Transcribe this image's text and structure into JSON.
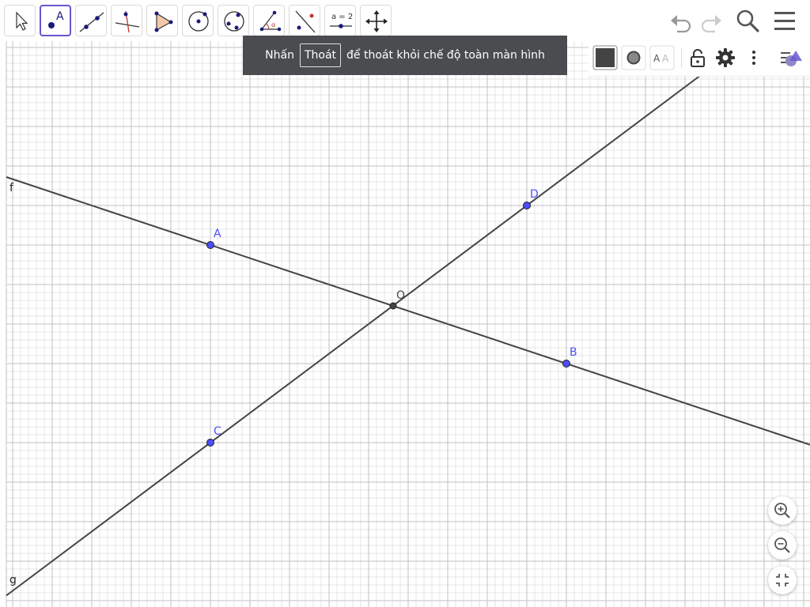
{
  "toolbar": {
    "tools": [
      {
        "name": "move-tool-icon"
      },
      {
        "name": "point-tool-icon",
        "glyph": "A"
      },
      {
        "name": "line-tool-icon"
      },
      {
        "name": "perpendicular-line-tool-icon"
      },
      {
        "name": "polygon-tool-icon"
      },
      {
        "name": "circle-center-point-tool-icon"
      },
      {
        "name": "circle-three-points-tool-icon"
      },
      {
        "name": "angle-tool-icon",
        "glyph": "α"
      },
      {
        "name": "reflect-line-tool-icon"
      },
      {
        "name": "slider-tool-icon",
        "glyph": "a = 2"
      },
      {
        "name": "move-graphics-view-tool-icon"
      }
    ],
    "right": [
      "undo-icon",
      "redo-icon",
      "search-icon",
      "menu-icon"
    ]
  },
  "banner": {
    "prefix": "Nhấn",
    "button": "Thoát",
    "suffix": "để thoát khỏi chế độ toàn màn hình"
  },
  "style_bar": {
    "buttons": [
      "color-icon",
      "point-style-icon",
      "label-style-icon",
      "lock-icon",
      "settings-icon",
      "more-icon",
      "algebra-view-toggle-icon"
    ]
  },
  "graphics": {
    "points": [
      {
        "label": "A",
        "color": "#4d4dff"
      },
      {
        "label": "B",
        "color": "#4d4dff"
      },
      {
        "label": "C",
        "color": "#4d4dff"
      },
      {
        "label": "D",
        "color": "#4d4dff"
      },
      {
        "label": "O",
        "color": "#444444"
      }
    ],
    "lines": [
      {
        "label": "f"
      },
      {
        "label": "g"
      }
    ],
    "colors": {
      "grid_major": "#c0c0c0",
      "grid_minor": "#e6e6e6",
      "line": "#444444",
      "point_label": "#4d4dff",
      "accent": "#6557d2"
    }
  },
  "zoom_controls": {
    "buttons": [
      "zoom-in-icon",
      "zoom-out-icon",
      "exit-fullscreen-icon"
    ]
  }
}
